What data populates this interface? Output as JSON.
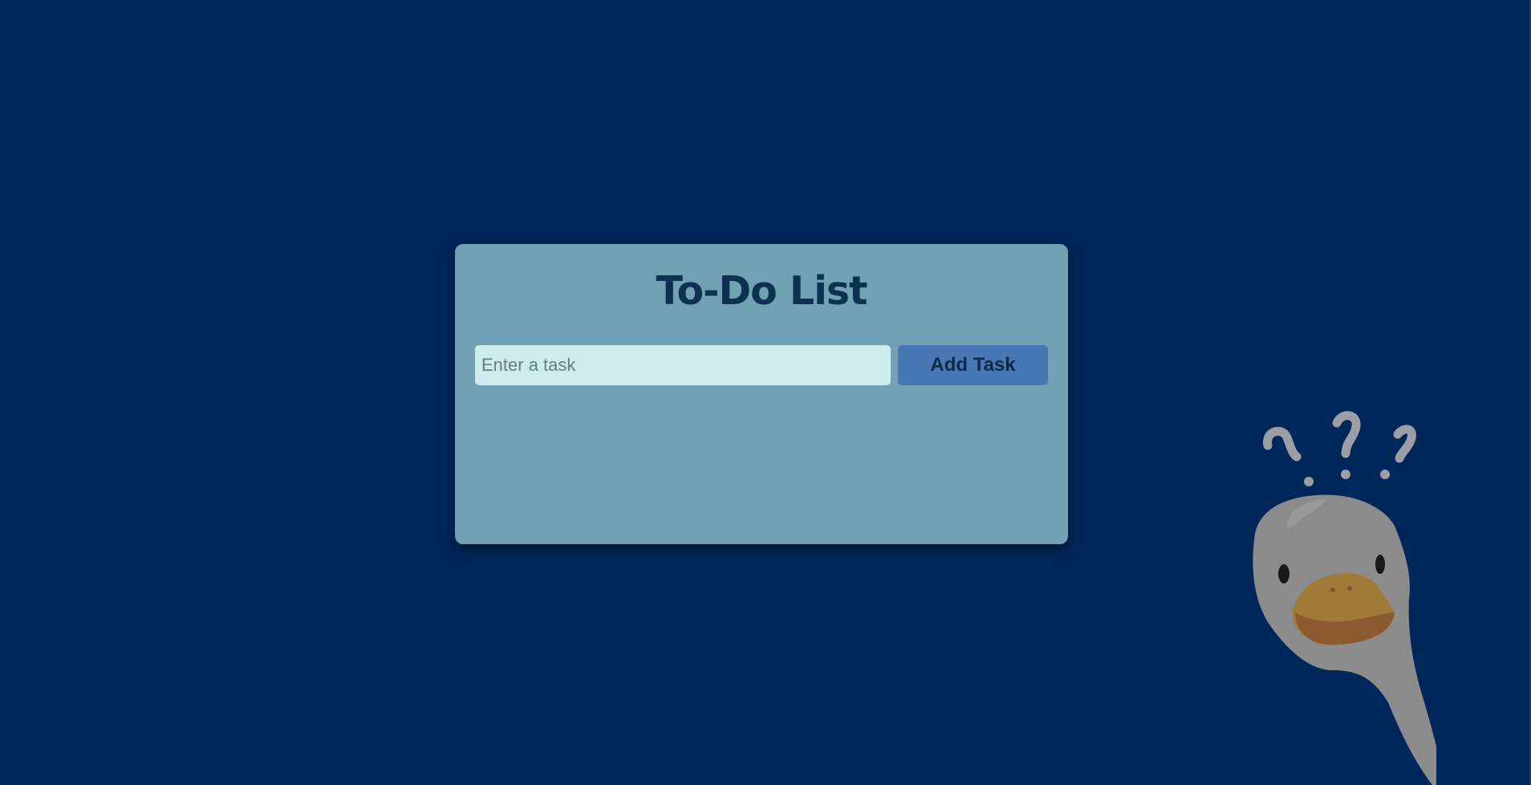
{
  "app": {
    "title": "To-Do List"
  },
  "task_form": {
    "input_value": "",
    "input_placeholder": "Enter a task",
    "add_button_label": "Add Task"
  },
  "tasks": [],
  "decoration": {
    "mascot_icon": "confused-goose-icon",
    "question_marks_icon": "question-marks-icon"
  },
  "colors": {
    "background": "#00275a",
    "card": "#72a1b3",
    "title": "#0c3250",
    "input_background": "#cceced",
    "button": "#4878b4",
    "button_text": "#0c2a44"
  }
}
